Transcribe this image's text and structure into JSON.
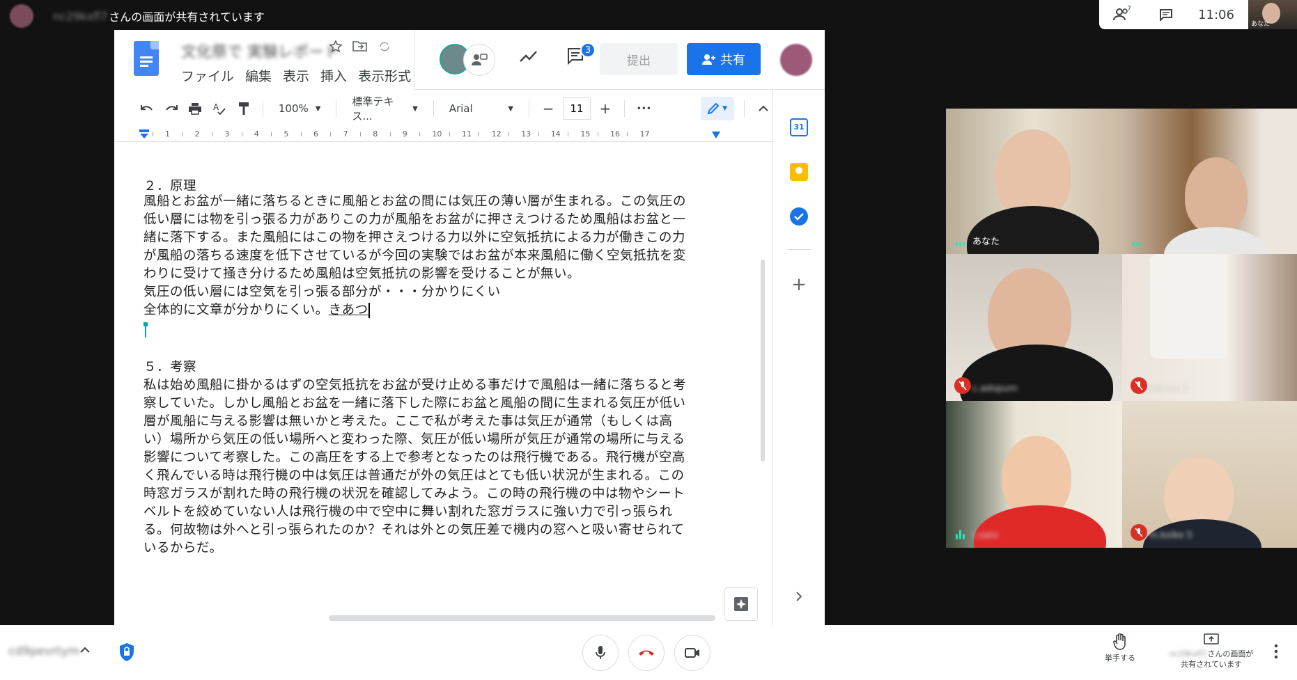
{
  "top_bar": {
    "presenter_name": "nc29kxfl7",
    "presenting_text": "さんの画面が共有されています",
    "people_count": "7",
    "time": "11:06",
    "self_label": "あなた"
  },
  "docs": {
    "title": "文化祭で 実験レポート",
    "menu": [
      "ファイル",
      "編集",
      "表示",
      "挿入",
      "表示形式"
    ],
    "comment_count": "3",
    "submit_label": "提出",
    "share_label": "共有",
    "toolbar": {
      "zoom": "100%",
      "style": "標準テキス...",
      "font": "Arial",
      "font_size": "11",
      "more": "•••"
    },
    "ruler": [
      "1",
      "2",
      "3",
      "4",
      "5",
      "6",
      "7",
      "8",
      "9",
      "10",
      "11",
      "12",
      "13",
      "14",
      "15",
      "16",
      "17"
    ],
    "body": {
      "heading2": "２．原理",
      "para2_lines": [
        "風船とお盆が一緒に落ちるときに風船とお盆の間には気圧の薄い層が生まれる。この気圧の",
        "低い層には物を引っ張る力がありこの力が風船をお盆がに押さえつけるため風船はお盆と一",
        "緒に落下する。また風船にはこの物を押さえつける力以外に空気抵抗による力が働きこの力",
        "が風船の落ちる速度を低下させているが今回の実験ではお盆が本来風船に働く空気抵抗を変",
        "わりに受けて掻き分けるため風船は空気抵抗の影響を受けることが無い。"
      ],
      "comment_line1": "気圧の低い層には空気を引っ張る部分が・・・分かりにくい",
      "comment_line2": "全体的に文章が分かりにくい。",
      "comment_author": "きあつ",
      "heading5": "５．考察",
      "para5_lines": [
        "私は始め風船に掛かるはずの空気抵抗をお盆が受け止める事だけで風船は一緒に落ちると考",
        "察していた。しかし風船とお盆を一緒に落下した際にお盆と風船の間に生まれる気圧が低い",
        "層が風船に与える影響は無いかと考えた。ここで私が考えた事は気圧が通常（もしくは高",
        "い）場所から気圧の低い場所へと変わった際、気圧が低い場所が気圧が通常の場所に与える",
        "影響について考察した。この高圧をする上で参考となったのは飛行機である。飛行機が空高",
        "く飛んでいる時は飛行機の中は気圧は普通だが外の気圧はとても低い状況が生まれる。この",
        "時窓ガラスが割れた時の飛行機の状況を確認してみよう。この時の飛行機の中は物やシート",
        "ベルトを絞めていない人は飛行機の中で空中に舞い割れた窓ガラスに強い力で引っ張られ",
        "る。何故物は外へと引っ張られたのか？それは外との気圧差で機内の窓へと吸い寄せられて",
        "いるからだ。"
      ]
    }
  },
  "participants": [
    {
      "name": "あなた",
      "state": "speaking"
    },
    {
      "name": "",
      "state": "speaking"
    },
    {
      "name": "c.adopum",
      "state": "muted"
    },
    {
      "name": "fukuda 3",
      "state": "muted"
    },
    {
      "name": "t.sato",
      "state": "speaking"
    },
    {
      "name": "m.koike 5",
      "state": "muted"
    }
  ],
  "bottom_bar": {
    "meeting_code": "cd9pevrtym",
    "raise_hand": "挙手する",
    "presenting_name": "nc29kxfl7",
    "presenting_line1": "さんの画面が",
    "presenting_line2": "共有されています"
  },
  "colors": {
    "accent": "#1a73e8",
    "danger": "#d93025",
    "speaking": "#1de9b6",
    "bg": "#121212"
  }
}
